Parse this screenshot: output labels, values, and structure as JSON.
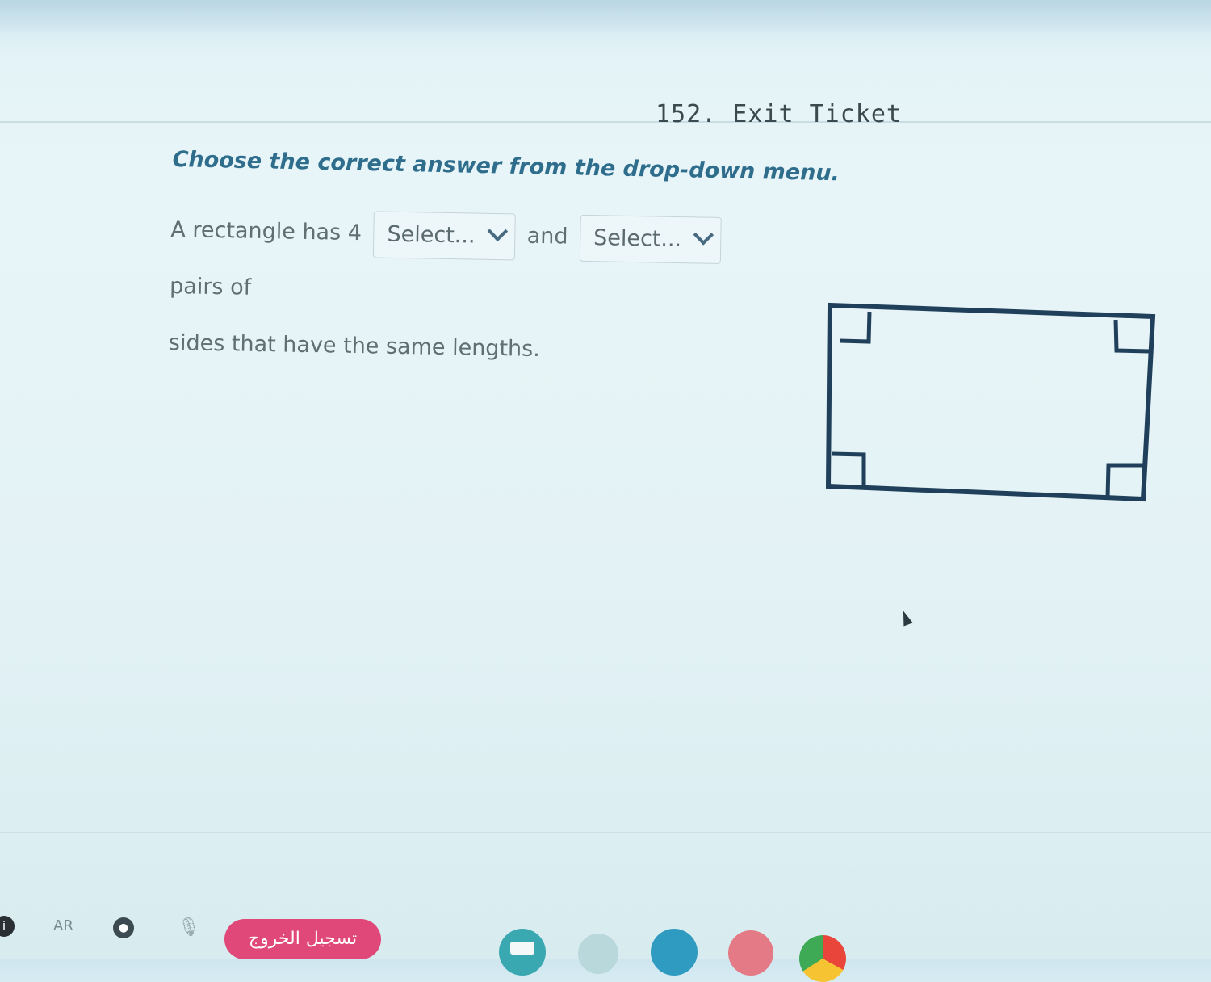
{
  "header": {
    "title": "152. Exit Ticket"
  },
  "instruction": "Choose the correct answer from the drop-down menu.",
  "question": {
    "text_before": "A rectangle has 4",
    "dropdown_1": {
      "value": "Select..."
    },
    "text_middle": "and",
    "dropdown_2": {
      "value": "Select..."
    },
    "text_after_1": "pairs of",
    "text_after_2": "sides that have the same lengths."
  },
  "figure": {
    "shape": "rectangle",
    "right_angle_markers": 4,
    "stroke_color": "#1f3f5a"
  },
  "taskbar": {
    "left_icon": "info-icon",
    "language": "AR",
    "record_icon": "record-icon",
    "mic_icon": "microphone-icon",
    "exit_button_label": "تسجيل الخروج",
    "exit_button_color": "#e0487a",
    "apps": [
      "classroom-app-icon",
      "app-icon",
      "drive-icon",
      "music-app-icon",
      "chrome-icon"
    ]
  }
}
